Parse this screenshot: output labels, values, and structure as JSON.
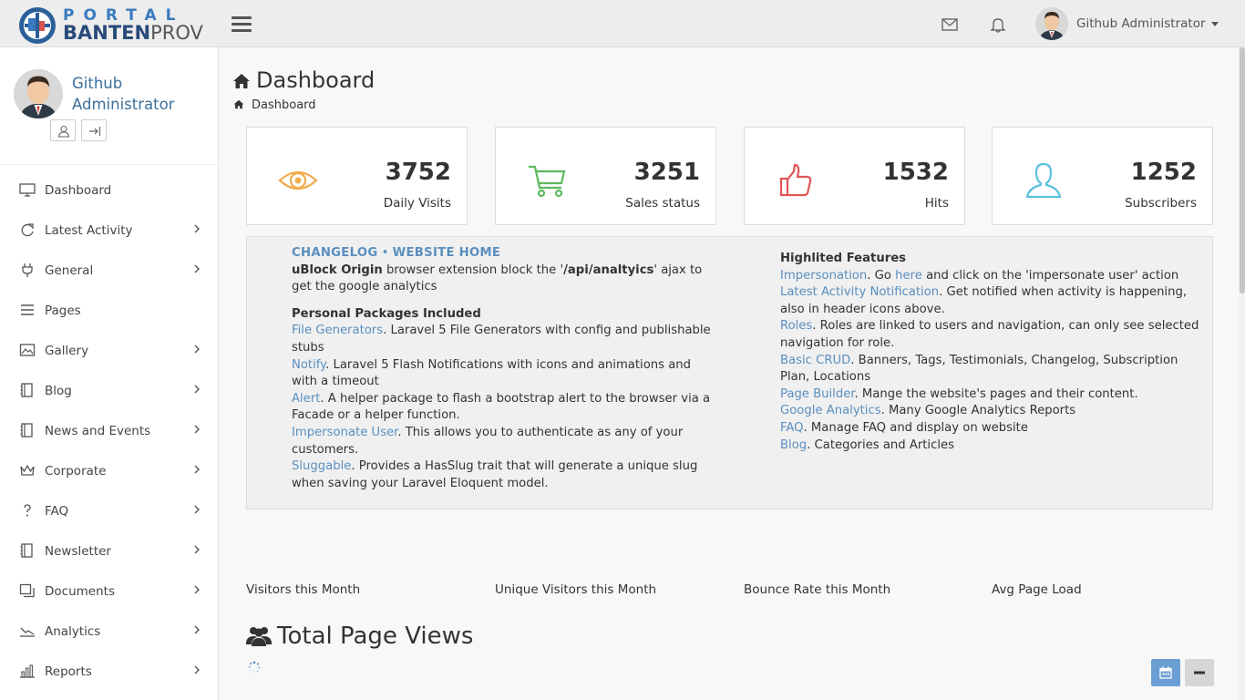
{
  "header": {
    "logo_top": "PORTAL",
    "logo_bottom_1": "BANTEN",
    "logo_bottom_2": "PROV",
    "user_name": "Github Administrator",
    "icons": [
      "menu-icon",
      "envelope-icon",
      "bell-icon"
    ]
  },
  "sidebar": {
    "profile_name": "Github Administrator",
    "items": [
      {
        "label": "Dashboard",
        "icon": "monitor-icon",
        "submenu": false
      },
      {
        "label": "Latest Activity",
        "icon": "refresh-icon",
        "submenu": true
      },
      {
        "label": "General",
        "icon": "plug-icon",
        "submenu": true
      },
      {
        "label": "Pages",
        "icon": "list-icon",
        "submenu": false
      },
      {
        "label": "Gallery",
        "icon": "image-icon",
        "submenu": true
      },
      {
        "label": "Blog",
        "icon": "notebook-icon",
        "submenu": true
      },
      {
        "label": "News and Events",
        "icon": "notebook-icon",
        "submenu": true
      },
      {
        "label": "Corporate",
        "icon": "crown-icon",
        "submenu": true
      },
      {
        "label": "FAQ",
        "icon": "question-icon",
        "submenu": true
      },
      {
        "label": "Newsletter",
        "icon": "notebook-icon",
        "submenu": true
      },
      {
        "label": "Documents",
        "icon": "copy-icon",
        "submenu": true
      },
      {
        "label": "Analytics",
        "icon": "chart-line-icon",
        "submenu": true
      },
      {
        "label": "Reports",
        "icon": "bar-chart-icon",
        "submenu": true
      }
    ]
  },
  "page": {
    "title": "Dashboard",
    "breadcrumb": "Dashboard"
  },
  "stats": [
    {
      "value": "3752",
      "label": "Daily Visits",
      "icon": "eye-icon",
      "color": "#f0ad4e"
    },
    {
      "value": "3251",
      "label": "Sales status",
      "icon": "cart-icon",
      "color": "#5cb85c"
    },
    {
      "value": "1532",
      "label": "Hits",
      "icon": "thumbs-up-icon",
      "color": "#e05555"
    },
    {
      "value": "1252",
      "label": "Subscribers",
      "icon": "user-icon",
      "color": "#5bc0de"
    }
  ],
  "info": {
    "changelog": "CHANGELOG",
    "sep": "•",
    "website_home": "WEBSITE HOME",
    "ublock_bold": "uBlock Origin",
    "ublock_text_1": " browser extension block the '",
    "ublock_path": "/api/analtyics",
    "ublock_text_2": "' ajax to get the google analytics",
    "packages_title": "Personal Packages Included",
    "packages": [
      {
        "link": "File Generators",
        "text": ". Laravel 5 File Generators with config and publishable stubs"
      },
      {
        "link": "Notify",
        "text": ". Laravel 5 Flash Notifications with icons and animations and with a timeout"
      },
      {
        "link": "Alert",
        "text": ". A helper package to flash a bootstrap alert to the browser via a Facade or a helper function."
      },
      {
        "link": "Impersonate User",
        "text": ". This allows you to authenticate as any of your customers."
      },
      {
        "link": "Sluggable",
        "text": ". Provides a HasSlug trait that will generate a unique slug when saving your Laravel Eloquent model."
      }
    ],
    "features_title": "Highlited Features",
    "imp_link": "Impersonation",
    "imp_text_1": ". Go ",
    "imp_here": "here",
    "imp_text_2": " and click on the 'impersonate user' action",
    "features": [
      {
        "link": "Latest Activity Notification",
        "text": ". Get notified when activity is happening, also in header icons above."
      },
      {
        "link": "Roles",
        "text": ". Roles are linked to users and navigation, can only see selected navigation for role."
      },
      {
        "link": "Basic CRUD",
        "text": ". Banners, Tags, Testimonials, Changelog, Subscription Plan, Locations"
      },
      {
        "link": "Page Builder",
        "text": ". Mange the website's pages and their content."
      },
      {
        "link": "Google Analytics",
        "text": ". Many Google Analytics Reports"
      },
      {
        "link": "FAQ",
        "text": ". Manage FAQ and display on website"
      },
      {
        "link": "Blog",
        "text": ". Categories and Articles"
      }
    ]
  },
  "metrics": [
    "Visitors this Month",
    "Unique Visitors this Month",
    "Bounce Rate this Month",
    "Avg Page Load"
  ],
  "total_page_views": "Total Page Views",
  "colors": {
    "link": "#5a8fbf",
    "calendar_button": "#6a9fd4",
    "minus_button": "#d6d6d6"
  }
}
